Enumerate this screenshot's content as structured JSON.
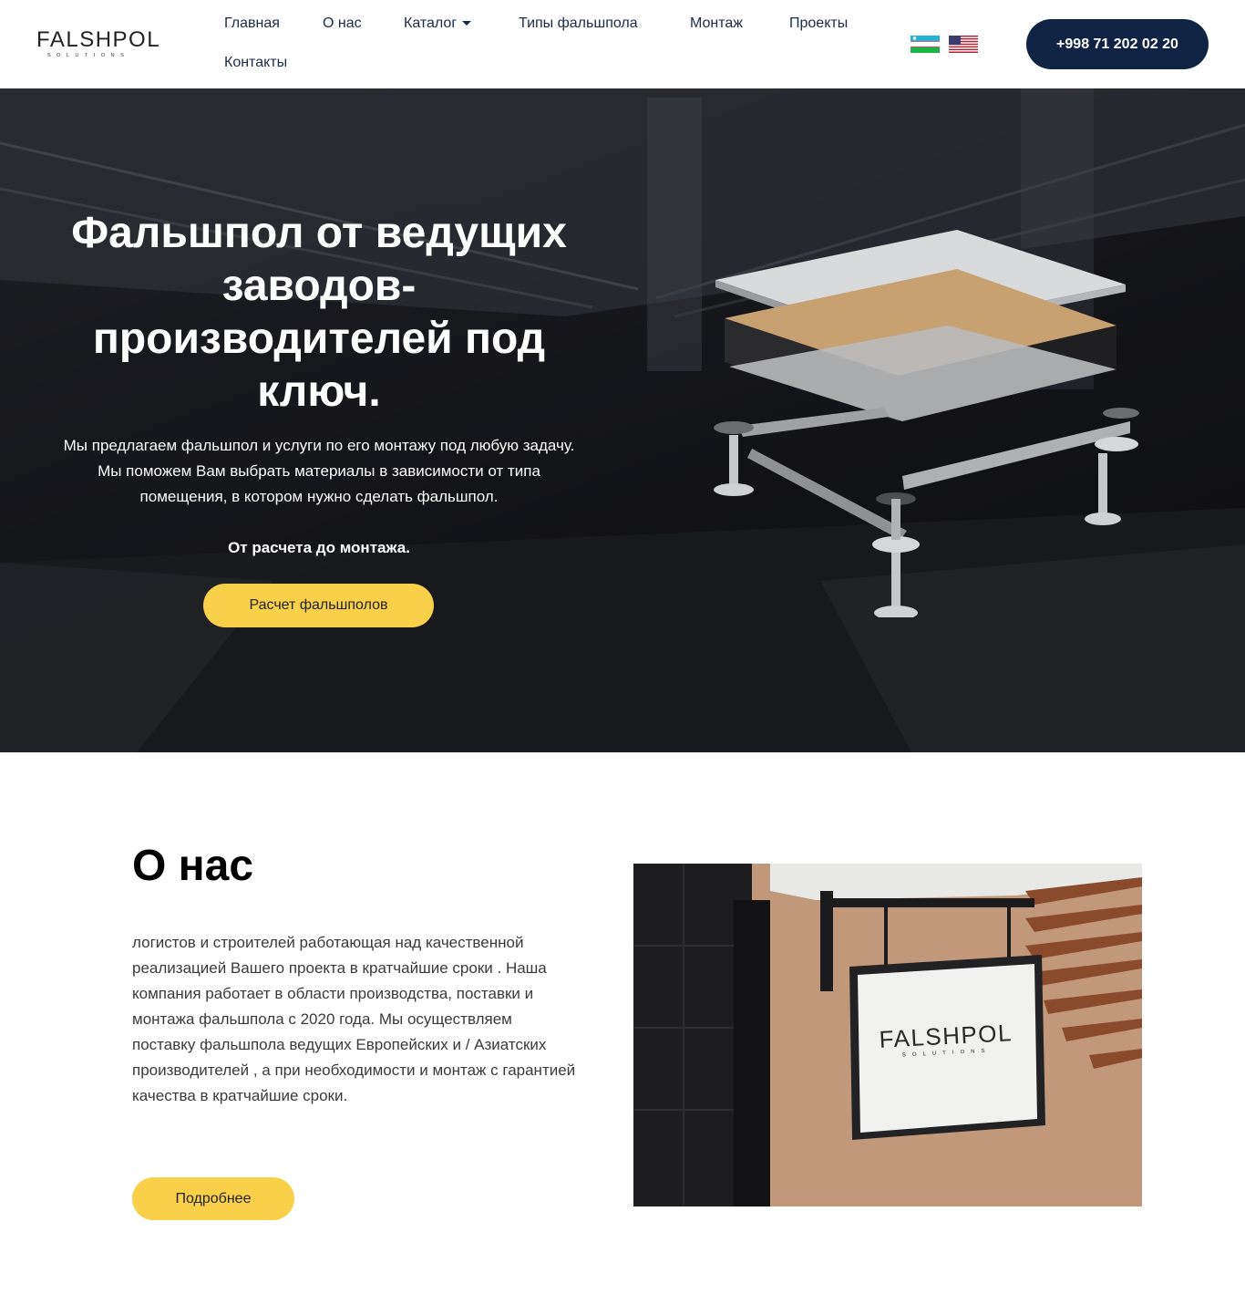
{
  "header": {
    "logo_main": "FALSHPOL",
    "logo_sub": "SOLUTIONS",
    "nav": [
      {
        "label": "Главная"
      },
      {
        "label": "О нас"
      },
      {
        "label": "Каталог"
      },
      {
        "label": "Типы фальшпола"
      },
      {
        "label": "Монтаж"
      },
      {
        "label": "Проекты"
      },
      {
        "label": "Контакты"
      }
    ],
    "flags": [
      "uzbekistan-flag-icon",
      "usa-flag-icon"
    ],
    "phone": "+998 71 202 02 20"
  },
  "hero": {
    "title": "Фальшпол от ведущих заводов-производителей под ключ.",
    "text": "Мы предлагаем фальшпол и услуги по его монтажу под любую задачу. Мы поможем Вам выбрать материалы в зависимости от типа помещения, в котором нужно сделать фальшпол.",
    "strong": "От расчета до монтажа.",
    "button": "Расчет фальшполов"
  },
  "about": {
    "title": "О нас",
    "text": "логистов и строителей работающая над качественной реализацией Вашего проекта в кратчайшие сроки . Наша компания работает в области производства, поставки и монтажа фальшпола с 2020 года. Мы осуществляем поставку фальшпола ведущих Европейских и / Азиатских производителей , а при необходимости и монтаж с гарантией качества в кратчайшие сроки.",
    "button": "Подробнее",
    "sign_main": "FALSHPOL",
    "sign_sub": "SOLUTIONS"
  },
  "colors": {
    "accent_yellow": "#f9d04a",
    "navy": "#0f2445",
    "nav_text": "#1e2a4a"
  }
}
